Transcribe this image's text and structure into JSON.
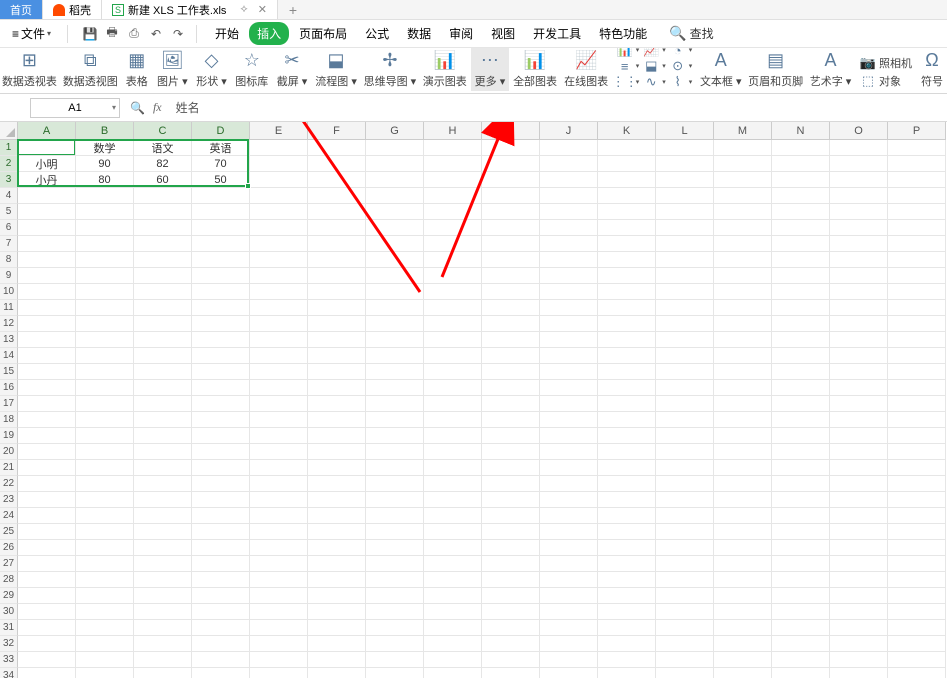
{
  "tabs": {
    "home": "首页",
    "dao": "稻壳",
    "doc": "新建 XLS 工作表.xls",
    "pin_glyph": "⟡",
    "close_glyph": "✕",
    "plus_glyph": "+"
  },
  "menubar": {
    "file": "文件",
    "qicons": {
      "save": "💾",
      "print": "🖶",
      "preview": "⎙",
      "undo": "↶",
      "redo": "↷"
    },
    "tabs": [
      "开始",
      "插入",
      "页面布局",
      "公式",
      "数据",
      "审阅",
      "视图",
      "开发工具",
      "特色功能"
    ],
    "active_tab_index": 1,
    "search": "查找",
    "search_glyph": "🔍"
  },
  "ribbon": {
    "items": [
      {
        "label": "数据透视表",
        "glyph": "⊞",
        "dd": false
      },
      {
        "label": "数据透视图",
        "glyph": "⧉",
        "dd": false
      },
      {
        "label": "表格",
        "glyph": "▦",
        "dd": false
      },
      {
        "label": "图片",
        "glyph": "🖼",
        "dd": true
      },
      {
        "label": "形状",
        "glyph": "◇",
        "dd": true
      },
      {
        "label": "图标库",
        "glyph": "☆",
        "dd": false
      },
      {
        "label": "截屏",
        "glyph": "✂",
        "dd": true
      },
      {
        "label": "流程图",
        "glyph": "⬓",
        "dd": true
      },
      {
        "label": "思维导图",
        "glyph": "✢",
        "dd": true
      },
      {
        "label": "演示图表",
        "glyph": "📊",
        "dd": false
      },
      {
        "label": "更多",
        "glyph": "⋯",
        "dd": true,
        "highlighted": true
      },
      {
        "label": "全部图表",
        "glyph": "📊",
        "dd": false
      },
      {
        "label": "在线图表",
        "glyph": "📈",
        "dd": false
      }
    ],
    "small_charts": [
      {
        "glyph": "📊"
      },
      {
        "glyph": "📈"
      },
      {
        "glyph": "◔"
      },
      {
        "glyph": "≡"
      },
      {
        "glyph": "⬓"
      },
      {
        "glyph": "⊙"
      },
      {
        "glyph": "⋮⋮"
      },
      {
        "glyph": "∿"
      },
      {
        "glyph": "⌇"
      }
    ],
    "right": [
      {
        "label": "文本框",
        "glyph": "A",
        "dd": true
      },
      {
        "label": "页眉和页脚",
        "glyph": "▤",
        "dd": false
      },
      {
        "label": "艺术字",
        "glyph": "A",
        "dd": true
      }
    ],
    "far_right": [
      {
        "label": "照相机",
        "glyph": "📷"
      },
      {
        "label": "对象",
        "glyph": "⬚"
      }
    ],
    "symbol_label": "符号"
  },
  "fbar": {
    "namebox": "A1",
    "fx": "fx",
    "magnify": "🔍",
    "formula_value": "姓名"
  },
  "columns": [
    "A",
    "B",
    "C",
    "D",
    "E",
    "F",
    "G",
    "H",
    "I",
    "J",
    "K",
    "L",
    "M",
    "N",
    "O",
    "P"
  ],
  "selected_cols": [
    0,
    1,
    2,
    3
  ],
  "selected_rows": [
    0,
    1,
    2
  ],
  "row_count": 34,
  "table": [
    [
      "姓名",
      "数学",
      "语文",
      "英语"
    ],
    [
      "小明",
      "90",
      "82",
      "70"
    ],
    [
      "小丹",
      "80",
      "60",
      "50"
    ]
  ],
  "colors": {
    "accent_green": "#22a54b",
    "arrow_red": "#ff0000"
  }
}
